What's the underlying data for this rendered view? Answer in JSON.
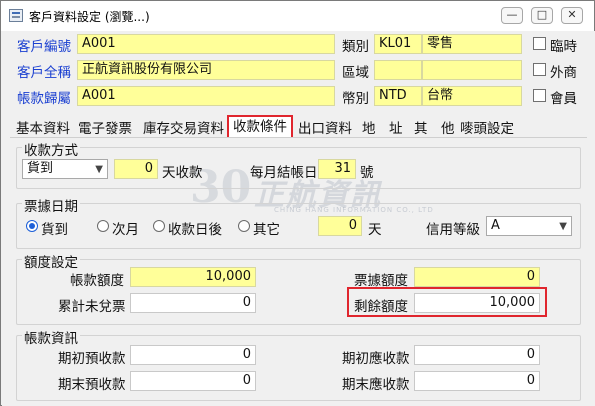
{
  "window": {
    "title": "客戶資料設定 (瀏覽...)",
    "buttons": {
      "minimize": "—",
      "maximize": "□",
      "close": "✕"
    }
  },
  "header": {
    "customer_code": {
      "label": "客戶編號",
      "value": "A001"
    },
    "customer_name": {
      "label": "客戶全稱",
      "value": "正航資訊股份有限公司"
    },
    "account_owner": {
      "label": "帳款歸屬",
      "value": "A001"
    },
    "category": {
      "label": "類別",
      "code": "KL01",
      "name": "零售"
    },
    "region": {
      "label": "區域",
      "code": "",
      "name": ""
    },
    "currency": {
      "label": "幣別",
      "code": "NTD",
      "name": "台幣"
    },
    "checkboxes": [
      {
        "label": "臨時",
        "checked": false
      },
      {
        "label": "外商",
        "checked": false
      },
      {
        "label": "會員",
        "checked": false
      }
    ]
  },
  "tabs": [
    "基本資料",
    "電子發票",
    "庫存交易資料",
    "收款條件",
    "出口資料",
    "地　址",
    "其　他",
    "嘜頭設定"
  ],
  "active_tab": "收款條件",
  "collection": {
    "group_title": "收款方式",
    "method": "貨到",
    "days": "0",
    "days_label": "天收款",
    "closing_label": "每月結帳日",
    "closing_day": "31",
    "closing_suffix": "號"
  },
  "bill_date": {
    "group_title": "票據日期",
    "options": [
      "貨到",
      "次月",
      "收款日後",
      "其它"
    ],
    "selected": "貨到",
    "days": "0",
    "days_suffix": "天",
    "credit_label": "信用等級",
    "credit_level": "A"
  },
  "credit_limit": {
    "group_title": "額度設定",
    "account_limit_label": "帳款額度",
    "account_limit": "10,000",
    "bill_limit_label": "票據額度",
    "bill_limit": "0",
    "accum_unredeemed_label": "累計未兌票",
    "accum_unredeemed": "0",
    "remaining_label": "剩餘額度",
    "remaining": "10,000"
  },
  "account_info": {
    "group_title": "帳款資訊",
    "opening_prepaid_label": "期初預收款",
    "opening_prepaid": "0",
    "opening_receivable_label": "期初應收款",
    "opening_receivable": "0",
    "closing_prepaid_label": "期末預收款",
    "closing_prepaid": "0",
    "closing_receivable_label": "期末應收款",
    "closing_receivable": "0"
  },
  "watermark": {
    "number": "30",
    "text": "正航資訊",
    "sub": "CHING HANG INFORMATION CO., LTD"
  },
  "colors": {
    "link_label": "#1a3fd1",
    "required_field": "#ffff99",
    "highlight": "#e0262e",
    "radio_selected": "#1c5fd8"
  }
}
